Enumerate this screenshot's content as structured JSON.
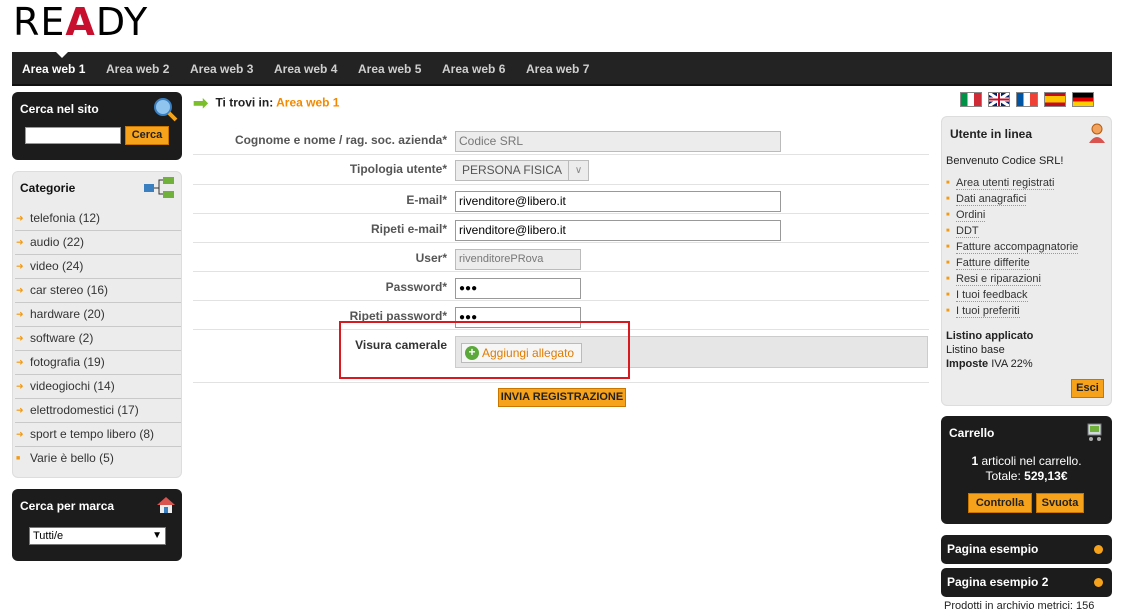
{
  "logo": {
    "text": "READY"
  },
  "nav": {
    "tabs": [
      "Area web 1",
      "Area web 2",
      "Area web 3",
      "Area web 4",
      "Area web 5",
      "Area web 6",
      "Area web 7"
    ],
    "active": "Area web 1"
  },
  "search": {
    "title": "Cerca nel sito",
    "button": "Cerca",
    "value": ""
  },
  "categories": {
    "title": "Categorie",
    "items": [
      "telefonia (12)",
      "audio (22)",
      "video (24)",
      "car stereo (16)",
      "hardware (20)",
      "software (2)",
      "fotografia (19)",
      "videogiochi (14)",
      "elettrodomestici (17)",
      "sport e tempo libero (8)",
      "Varie è bello (5)"
    ]
  },
  "brand": {
    "title": "Cerca per marca",
    "selected": "Tutti/e"
  },
  "breadcrumb": {
    "prefix": "Ti trovi in:",
    "current": "Area web 1"
  },
  "form": {
    "name": {
      "label": "Cognome e nome / rag. soc. azienda*",
      "value": "Codice SRL"
    },
    "type": {
      "label": "Tipologia utente*",
      "value": "PERSONA FISICA"
    },
    "email": {
      "label": "E-mail*",
      "value": "rivenditore@libero.it"
    },
    "email2": {
      "label": "Ripeti e-mail*",
      "value": "rivenditore@libero.it"
    },
    "user": {
      "label": "User*",
      "value": "rivenditorePRova"
    },
    "password": {
      "label": "Password*",
      "value": "●●●"
    },
    "password2": {
      "label": "Ripeti password*",
      "value": "●●●"
    },
    "visura": {
      "label": "Visura camerale",
      "button": "Aggiungi allegato"
    },
    "submit": "INVIA REGISTRAZIONE"
  },
  "flags": [
    "it",
    "gb",
    "fr",
    "es",
    "de"
  ],
  "user_panel": {
    "title": "Utente in linea",
    "welcome": "Benvenuto Codice SRL!",
    "links": [
      "Area utenti registrati",
      "Dati anagrafici",
      "Ordini",
      "DDT",
      "Fatture accompagnatorie",
      "Fatture differite",
      "Resi e riparazioni",
      "I tuoi feedback",
      "I tuoi preferiti"
    ],
    "listino_label": "Listino applicato",
    "listino_value": "Listino base",
    "imposte_label": "Imposte",
    "imposte_value": "IVA 22%",
    "logout": "Esci"
  },
  "cart": {
    "title": "Carrello",
    "count": "1",
    "count_suffix": " articoli nel carrello.",
    "total_label": "Totale: ",
    "total": "529,13€",
    "check": "Controlla",
    "empty": "Svuota"
  },
  "pages": [
    "Pagina esempio",
    "Pagina esempio 2"
  ],
  "footer_partial": "Prodotti in archivio metrici: 156",
  "colors": {
    "accent": "#f7a21b",
    "highlight": "#d71920",
    "dark": "#1c1c1c"
  }
}
